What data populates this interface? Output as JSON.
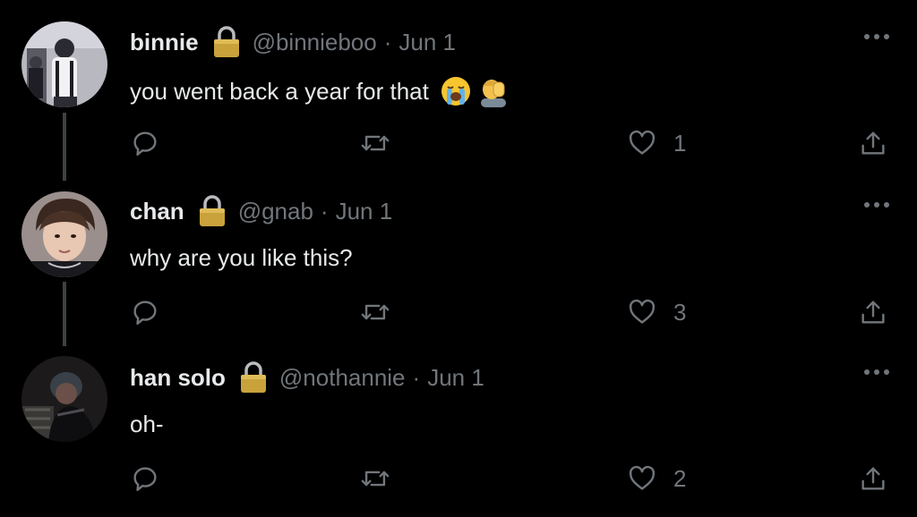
{
  "tweets": [
    {
      "display_name": "binnie",
      "handle": "@binnieboo",
      "separator": "·",
      "date": "Jun 1",
      "text": "you went back a year for that",
      "emojis": [
        "loudly-crying-face",
        "person-facepalming"
      ],
      "likes": "1",
      "protected_icon": "lock-icon"
    },
    {
      "display_name": "chan",
      "handle": "@gnab",
      "separator": "·",
      "date": "Jun 1",
      "text": "why are you like this?",
      "emojis": [],
      "likes": "3",
      "protected_icon": "lock-icon"
    },
    {
      "display_name": "han solo",
      "handle": "@nothannie",
      "separator": "·",
      "date": "Jun 1",
      "text": "oh-",
      "emojis": [],
      "likes": "2",
      "protected_icon": "lock-icon"
    }
  ],
  "icons": {
    "reply": "reply-icon",
    "retweet": "retweet-icon",
    "like": "heart-icon",
    "share": "share-icon",
    "more": "more-options-icon"
  },
  "colors": {
    "background": "#000000",
    "primary_text": "#e7e9ea",
    "secondary_text": "#71767b",
    "thread_line": "#3e4144"
  }
}
